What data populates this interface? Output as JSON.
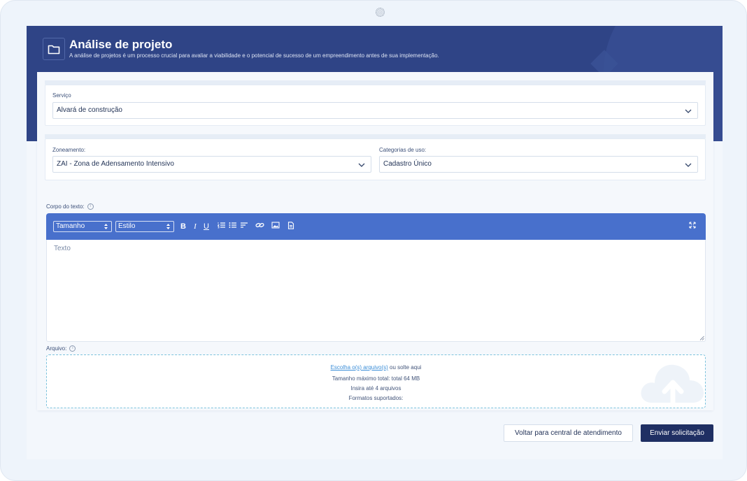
{
  "header": {
    "title": "Análise de projeto",
    "subtitle": "A análise de projetos é um processo crucial para avaliar a viabilidade e o potencial de sucesso de um empreendimento antes de sua implementação.",
    "icon": "folder-icon"
  },
  "servico": {
    "label": "Serviço",
    "value": "Alvará de construção"
  },
  "zoneamento": {
    "label": "Zoneamento:",
    "value": "ZAI - Zona de Adensamento Intensivo"
  },
  "categorias": {
    "label": "Categorias de uso:",
    "value": "Cadastro Único"
  },
  "editor": {
    "label": "Corpo do texto:",
    "size_select": "Tamanho",
    "style_select": "Estilo",
    "bold": "B",
    "italic": "I",
    "underline": "U",
    "placeholder": "Texto"
  },
  "upload": {
    "label": "Arquivo:",
    "choose_link": "Escolha o(s) arquivo(s)",
    "drop_text": "ou solte aqui",
    "max_size": "Tamanho máximo total: total 64 MB",
    "max_files": "Insira até 4 arquivos",
    "formats": "Formatos suportados:"
  },
  "actions": {
    "back": "Voltar para central de atendimento",
    "submit": "Enviar solicitação"
  },
  "colors": {
    "header_bg": "#2f4486",
    "toolbar_bg": "#4870cc",
    "primary_button": "#1f2f63",
    "link": "#3b8ed8"
  }
}
